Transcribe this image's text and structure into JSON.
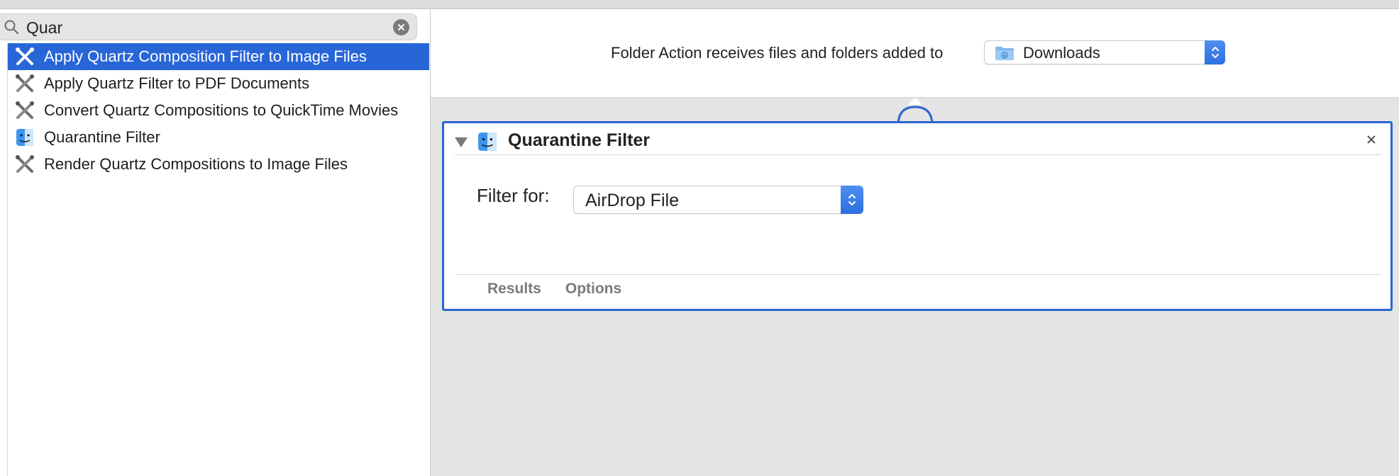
{
  "search": {
    "query": "Quar"
  },
  "library": {
    "items": [
      {
        "label": "Apply Quartz Composition Filter to Image Files",
        "icon": "quartz-tools-icon",
        "selected": true
      },
      {
        "label": "Apply Quartz Filter to PDF Documents",
        "icon": "quartz-tools-icon",
        "selected": false
      },
      {
        "label": "Convert Quartz Compositions to QuickTime Movies",
        "icon": "quartz-tools-icon",
        "selected": false
      },
      {
        "label": "Quarantine Filter",
        "icon": "finder-icon",
        "selected": false
      },
      {
        "label": "Render Quartz Compositions to Image Files",
        "icon": "quartz-tools-icon",
        "selected": false
      }
    ]
  },
  "workflow": {
    "folder_action_label": "Folder Action receives files and folders added to",
    "folder_value": "Downloads"
  },
  "action": {
    "title": "Quarantine Filter",
    "filter_label": "Filter for:",
    "filter_value": "AirDrop File",
    "tabs": [
      "Results",
      "Options"
    ]
  },
  "colors": {
    "selection": "#2866d8",
    "card_border": "#2a66cf",
    "stepper_blue": "#3a7de8"
  }
}
